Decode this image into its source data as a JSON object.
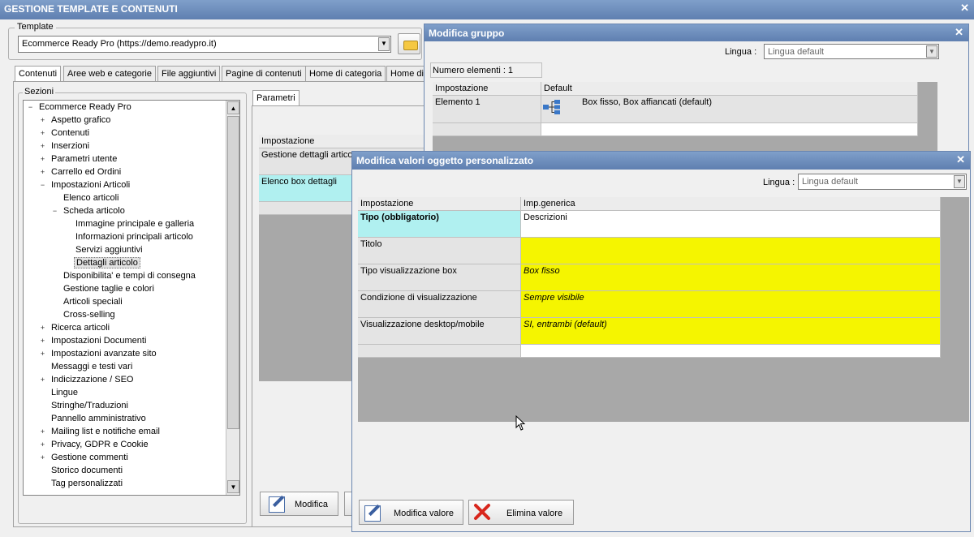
{
  "main": {
    "title": "GESTIONE TEMPLATE E CONTENUTI",
    "close_glyph": "✕",
    "template_label": "Template",
    "template_value": "Ecommerce Ready Pro (https://demo.readypro.it)",
    "tabs": [
      "Contenuti",
      "Aree web e categorie",
      "File aggiuntivi",
      "Pagine di contenuti",
      "Home di categoria",
      "Home di"
    ],
    "sections_label": "Sezioni",
    "tree": [
      {
        "label": "Ecommerce Ready Pro",
        "level": 0,
        "pm": "−"
      },
      {
        "label": "Aspetto grafico",
        "level": 1,
        "pm": "+"
      },
      {
        "label": "Contenuti",
        "level": 1,
        "pm": "+"
      },
      {
        "label": "Inserzioni",
        "level": 1,
        "pm": "+"
      },
      {
        "label": "Parametri utente",
        "level": 1,
        "pm": "+"
      },
      {
        "label": "Carrello ed Ordini",
        "level": 1,
        "pm": "+"
      },
      {
        "label": "Impostazioni Articoli",
        "level": 1,
        "pm": "−"
      },
      {
        "label": "Elenco articoli",
        "level": 2,
        "pm": ""
      },
      {
        "label": "Scheda articolo",
        "level": 2,
        "pm": "−"
      },
      {
        "label": "Immagine principale e galleria",
        "level": 3,
        "pm": ""
      },
      {
        "label": "Informazioni principali articolo",
        "level": 3,
        "pm": ""
      },
      {
        "label": "Servizi aggiuntivi",
        "level": 3,
        "pm": ""
      },
      {
        "label": "Dettagli articolo",
        "level": 3,
        "pm": "",
        "selected": true
      },
      {
        "label": "Disponibilita' e tempi di consegna",
        "level": 2,
        "pm": ""
      },
      {
        "label": "Gestione taglie e colori",
        "level": 2,
        "pm": ""
      },
      {
        "label": "Articoli speciali",
        "level": 2,
        "pm": ""
      },
      {
        "label": "Cross-selling",
        "level": 2,
        "pm": ""
      },
      {
        "label": "Ricerca articoli",
        "level": 1,
        "pm": "+"
      },
      {
        "label": "Impostazioni Documenti",
        "level": 1,
        "pm": "+"
      },
      {
        "label": "Impostazioni avanzate sito",
        "level": 1,
        "pm": "+"
      },
      {
        "label": "Messaggi e testi vari",
        "level": 1,
        "pm": ""
      },
      {
        "label": "Indicizzazione / SEO",
        "level": 1,
        "pm": "+"
      },
      {
        "label": "Lingue",
        "level": 1,
        "pm": ""
      },
      {
        "label": "Stringhe/Traduzioni",
        "level": 1,
        "pm": ""
      },
      {
        "label": "Pannello amministrativo",
        "level": 1,
        "pm": ""
      },
      {
        "label": "Mailing list e notifiche email",
        "level": 1,
        "pm": "+"
      },
      {
        "label": "Privacy, GDPR e Cookie",
        "level": 1,
        "pm": "+"
      },
      {
        "label": "Gestione commenti",
        "level": 1,
        "pm": "+"
      },
      {
        "label": "Storico documenti",
        "level": 1,
        "pm": ""
      },
      {
        "label": "Tag personalizzati",
        "level": 1,
        "pm": ""
      }
    ],
    "params_tab": "Parametri",
    "params_header": "Impostazione",
    "params_rows": [
      "Gestione dettagli artico",
      "Elenco box dettagli"
    ],
    "modify_button": "Modifica"
  },
  "gruppo": {
    "title": "Modifica gruppo",
    "close_glyph": "✕",
    "lingua_label": "Lingua :",
    "lingua_value": "Lingua default",
    "numero": "Numero elementi : 1",
    "col1": "Impostazione",
    "col2": "Default",
    "row_label": "Elemento 1",
    "row_value": "Box fisso, Box affiancati (default)"
  },
  "valori": {
    "title": "Modifica valori oggetto personalizzato",
    "close_glyph": "✕",
    "lingua_label": "Lingua :",
    "lingua_value": "Lingua default",
    "col1": "Impostazione",
    "col2": "Imp.generica",
    "rows": [
      {
        "label": "Tipo (obbligatorio)",
        "value": "Descrizioni"
      },
      {
        "label": "Titolo",
        "value": ""
      },
      {
        "label": "Tipo visualizzazione box",
        "value": "Box fisso"
      },
      {
        "label": "Condizione di visualizzazione",
        "value": "Sempre visibile"
      },
      {
        "label": "Visualizzazione desktop/mobile",
        "value": "SI, entrambi (default)"
      }
    ],
    "modify_button": "Modifica valore",
    "delete_button": "Elimina valore"
  },
  "colors": {
    "title_bar": "#6f8fc0",
    "required_cell": "#b0f0f0",
    "value_cell": "#f5f500"
  }
}
